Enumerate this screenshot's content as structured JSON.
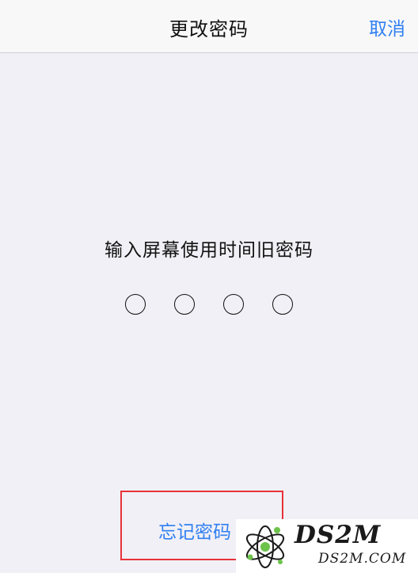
{
  "nav": {
    "title": "更改密码",
    "cancel_label": "取消"
  },
  "prompt": "输入屏幕使用时间旧密码",
  "passcode": {
    "digit_count": 4,
    "entered": 0
  },
  "forgot_label": "忘记密码",
  "watermark": {
    "brand": "DS2M",
    "site": "DS2M.COM"
  },
  "colors": {
    "accent": "#2f7ff2",
    "background": "#f1f0f6",
    "highlight": "#e8323a"
  }
}
